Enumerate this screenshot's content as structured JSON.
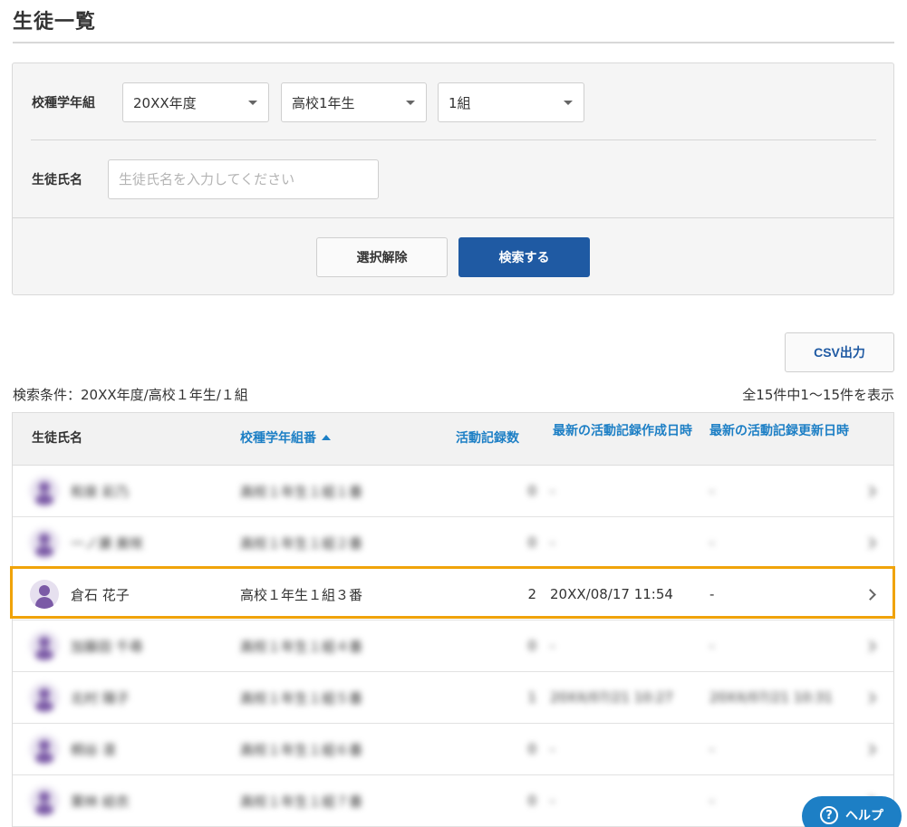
{
  "page": {
    "title": "生徒一覧"
  },
  "search": {
    "class_label": "校種学年組",
    "year_value": "20XX年度",
    "grade_value": "高校1年生",
    "class_value": "1組",
    "name_label": "生徒氏名",
    "name_placeholder": "生徒氏名を入力してください",
    "clear_label": "選択解除",
    "search_label": "検索する"
  },
  "toolbar": {
    "csv_label": "CSV出力"
  },
  "results": {
    "condition_text": "検索条件：20XX年度/高校１年生/１組",
    "count_text": "全15件中1～15件を表示"
  },
  "table": {
    "headers": {
      "name": "生徒氏名",
      "class": "校種学年組番",
      "count": "活動記録数",
      "created": "最新の活動記録作成日時",
      "updated": "最新の活動記録更新日時"
    },
    "rows": [
      {
        "name": "和泉 彩乃",
        "class": "高校１年生１組１番",
        "count": "0",
        "created": "-",
        "updated": "-"
      },
      {
        "name": "一ノ瀬 美咲",
        "class": "高校１年生１組２番",
        "count": "0",
        "created": "-",
        "updated": "-"
      },
      {
        "name": "倉石 花子",
        "class": "高校１年生１組３番",
        "count": "2",
        "created": "20XX/08/17 11:54",
        "updated": "-"
      },
      {
        "name": "加藤田 千尋",
        "class": "高校１年生１組４番",
        "count": "0",
        "created": "-",
        "updated": "-"
      },
      {
        "name": "北村 陽子",
        "class": "高校１年生１組５番",
        "count": "1",
        "created": "20XX/07/21 10:27",
        "updated": "20XX/07/21 10:31"
      },
      {
        "name": "桐谷 凛",
        "class": "高校１年生１組６番",
        "count": "0",
        "created": "-",
        "updated": "-"
      },
      {
        "name": "栗林 結衣",
        "class": "高校１年生１組７番",
        "count": "0",
        "created": "-",
        "updated": "-"
      }
    ]
  },
  "help": {
    "label": "ヘルプ",
    "icon": "?"
  },
  "colors": {
    "primary": "#1f5aa3",
    "link": "#1d7fc5",
    "highlight": "#f0a30a"
  }
}
